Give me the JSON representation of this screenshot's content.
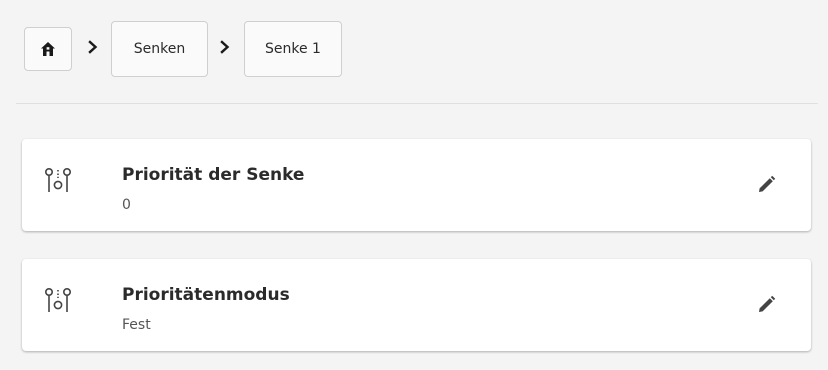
{
  "breadcrumb": {
    "home_icon": "home-icon",
    "separator_icon": "chevron-right-icon",
    "items": [
      {
        "label": "Senken"
      },
      {
        "label": "Senke 1"
      }
    ]
  },
  "settings": [
    {
      "title": "Priorität der Senke",
      "value": "0",
      "icon": "priority-sliders-icon",
      "action_icon": "pencil-icon"
    },
    {
      "title": "Prioritätenmodus",
      "value": "Fest",
      "icon": "priority-sliders-icon",
      "action_icon": "pencil-icon"
    }
  ],
  "colors": {
    "background": "#f4f4f4",
    "card": "#ffffff",
    "text": "#2b2b2b",
    "icon": "#444444"
  }
}
